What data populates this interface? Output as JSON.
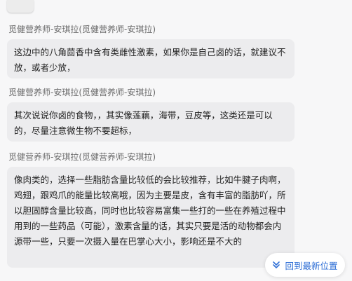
{
  "top_stub": {
    "label": "..."
  },
  "messages": [
    {
      "sender": "觅健营养师-安琪拉(觅健营养师-安琪拉)",
      "text": "这边中的八角茴香中含有类雌性激素，如果你是自己卤的话，就建议不放，或者少放，"
    },
    {
      "sender": "觅健营养师-安琪拉(觅健营养师-安琪拉)",
      "text": "其次说说你卤的食物，，其实像莲藕，海带，豆皮等，这类还是可以的，尽量注意微生物不要超标，"
    },
    {
      "sender": "觅健营养师-安琪拉(觅健营养师-安琪拉)",
      "text": "像肉类的，选择一些脂肪含量比较低的会比较推荐，比如牛腱子肉啊，鸡翅，跟鸡爪的能量比较高哦，因为主要是皮，含有丰富的脂肪吖，所以胆固醇含量比较高，同时也比较容易富集一些打的一些在养殖过程中用到的一些药品（可能），激素含量的话，其实只要是活的动物都会内源带一些，只要一次摄入量在巴掌心大小，影响还是不大的"
    }
  ],
  "scroll_button": {
    "label": "回到最新位置",
    "icon": "double-chevron-down-icon",
    "accent": "#2f6fd6"
  }
}
